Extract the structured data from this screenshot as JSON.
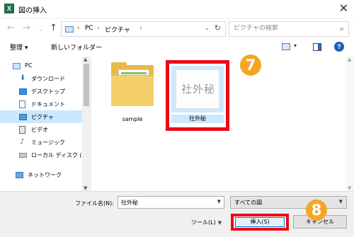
{
  "window": {
    "app_icon": "X",
    "title": "図の挿入",
    "close_glyph": "✕"
  },
  "nav": {
    "back_glyph": "←",
    "forward_glyph": "→",
    "dropdown_glyph": "⌄",
    "up_glyph": "↑"
  },
  "address": {
    "segments": [
      "PC",
      "ピクチャ"
    ],
    "separator": "›",
    "dropdown_glyph": "⌄",
    "refresh_glyph": "↻"
  },
  "search": {
    "placeholder": "ピクチャの検索",
    "icon": "search-icon"
  },
  "toolbar": {
    "organize_label": "整理 ▾",
    "new_folder_label": "新しいフォルダー",
    "view_dropdown": "▾",
    "help_glyph": "?"
  },
  "sidebar": {
    "items": [
      {
        "label": "PC",
        "icon": "pc-icon"
      },
      {
        "label": "ダウンロード",
        "icon": "download-icon"
      },
      {
        "label": "デスクトップ",
        "icon": "desktop-icon"
      },
      {
        "label": "ドキュメント",
        "icon": "documents-icon"
      },
      {
        "label": "ピクチャ",
        "icon": "pictures-icon",
        "selected": true
      },
      {
        "label": "ビデオ",
        "icon": "video-icon"
      },
      {
        "label": "ミュージック",
        "icon": "music-icon"
      },
      {
        "label": "ローカル ディスク (C",
        "icon": "disk-icon"
      },
      {
        "label": "ネットワーク",
        "icon": "network-icon"
      }
    ]
  },
  "files": [
    {
      "name": "sample",
      "type": "folder"
    },
    {
      "name": "社外秘",
      "type": "image",
      "selected": true,
      "stamp": "社外秘"
    }
  ],
  "annotations": {
    "step7": "7",
    "step8": "8",
    "color": "#f5a623",
    "highlight_color": "#ea0c18"
  },
  "bottom": {
    "filename_label": "ファイル名(N):",
    "filename_value": "社外秘",
    "filetype_value": "すべての図",
    "tools_label": "ツール(L)",
    "insert_label": "挿入(S)",
    "cancel_label": "キャンセル"
  }
}
